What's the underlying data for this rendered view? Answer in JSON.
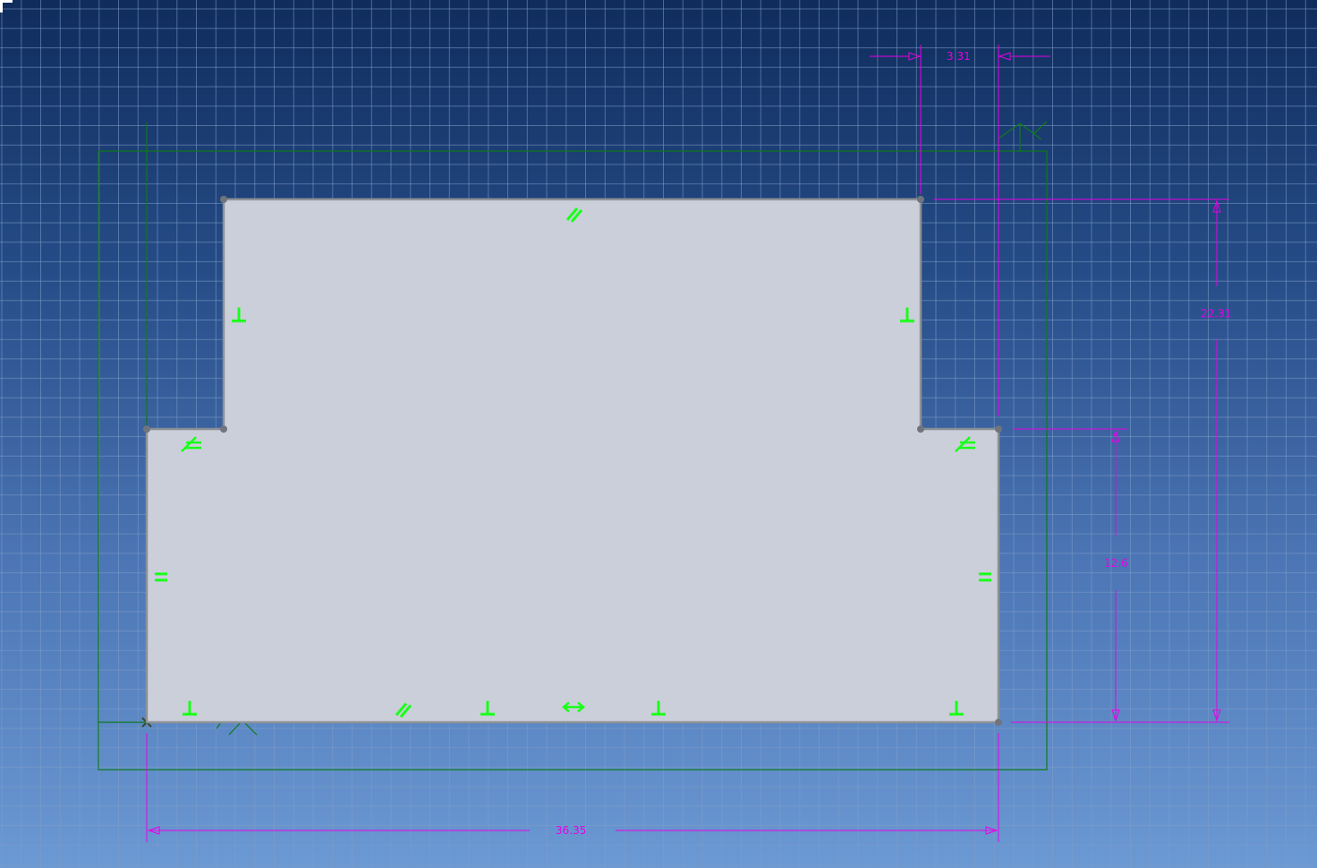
{
  "sketch": {
    "profile_fill": "#cbcfda",
    "profile_stroke": "#8e9196",
    "vertex_color": "#70757d",
    "grid_color": "#7f9cc8",
    "bbox_color": "#0e7a1a",
    "constraint_color": "#19ff19",
    "dimension_color": "#e800e8"
  },
  "dimensions": {
    "top_gap": "3.31",
    "overall_height": "22.31",
    "lower_height": "12.6",
    "overall_width": "36.35"
  },
  "constraints": {
    "parallel": "parallel-icon",
    "perpendicular": "perpendicular-icon",
    "equal": "equal-icon",
    "horizontal": "horizontal-icon",
    "collinear": "collinear-icon"
  }
}
